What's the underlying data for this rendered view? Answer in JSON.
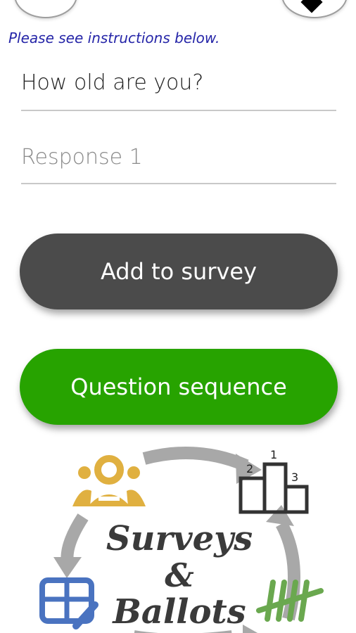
{
  "instructions": "Please see instructions below.",
  "question_field": {
    "value": "How old are you?"
  },
  "response_field": {
    "placeholder": "Response 1"
  },
  "add_button": {
    "label": "Add to survey"
  },
  "sequence_button": {
    "label": "Question sequence"
  },
  "logo": {
    "line1": "Surveys",
    "line2": "&",
    "line3": "Ballots",
    "podium_ranks": [
      "1",
      "2",
      "3"
    ]
  },
  "colors": {
    "instructions": "#2525a8",
    "add_button": "#4b4b4b",
    "sequence_button": "#27a300",
    "people_icon": "#e0b040",
    "table_icon": "#4a73c0",
    "tally_icon": "#6aa84f",
    "cycle_arrows": "#a8a8a8"
  },
  "icons": [
    "people-icon",
    "podium-icon",
    "table-edit-icon",
    "tally-icon",
    "cycle-arrows-icon"
  ]
}
